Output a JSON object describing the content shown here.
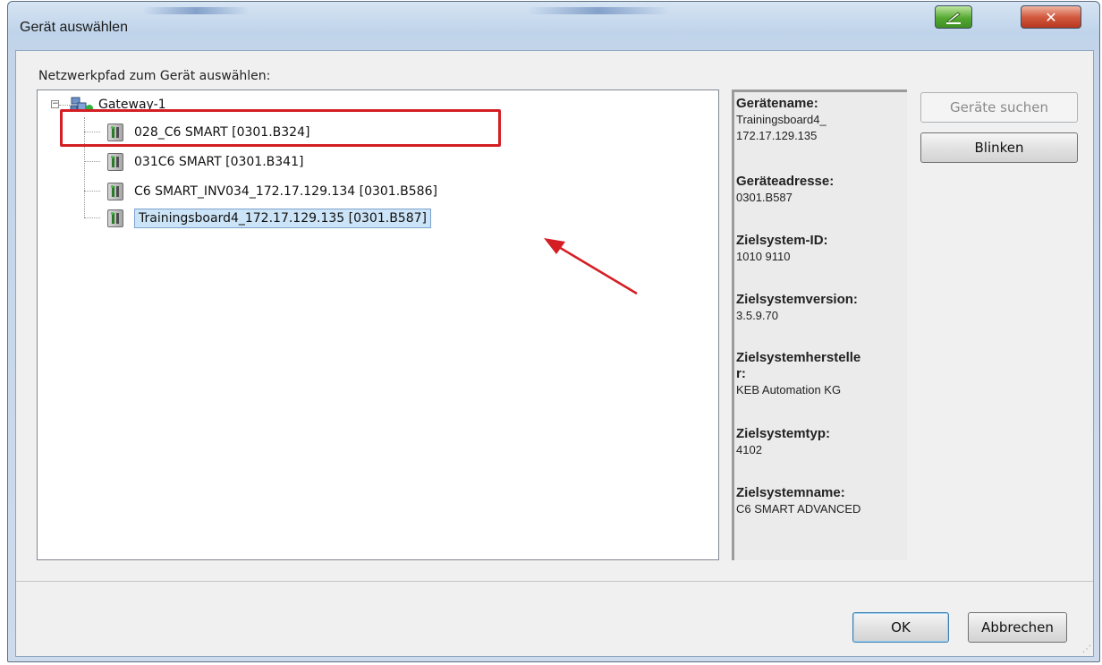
{
  "window": {
    "title": "Gerät auswählen"
  },
  "dialog": {
    "path_label": "Netzwerkpfad zum Gerät auswählen:",
    "tree": {
      "gateway": "Gateway-1",
      "devices": [
        "028_C6 SMART [0301.B324]",
        "031C6 SMART [0301.B341]",
        "C6 SMART_INV034_172.17.129.134 [0301.B586]",
        "Trainingsboard4_172.17.129.135 [0301.B587]"
      ],
      "selected_index": 3
    },
    "info": [
      {
        "label": "Gerätename:",
        "value": "Trainingsboard4_\n172.17.129.135"
      },
      {
        "label": "Geräteadresse:",
        "value": "0301.B587"
      },
      {
        "label": "Zielsystem-ID:",
        "value": "1010 9110"
      },
      {
        "label": "Zielsystemversion:",
        "value": "3.5.9.70"
      },
      {
        "label": "Zielsystemherstelle\nr:",
        "value": "KEB Automation KG"
      },
      {
        "label": "Zielsystemtyp:",
        "value": "4102"
      },
      {
        "label": "Zielsystemname:",
        "value": "C6 SMART ADVANCED"
      }
    ],
    "buttons": {
      "search": "Geräte suchen",
      "blink": "Blinken",
      "ok": "OK",
      "cancel": "Abbrechen"
    }
  },
  "colors": {
    "highlight": "#d41e24",
    "selection": "#cce4f7"
  }
}
